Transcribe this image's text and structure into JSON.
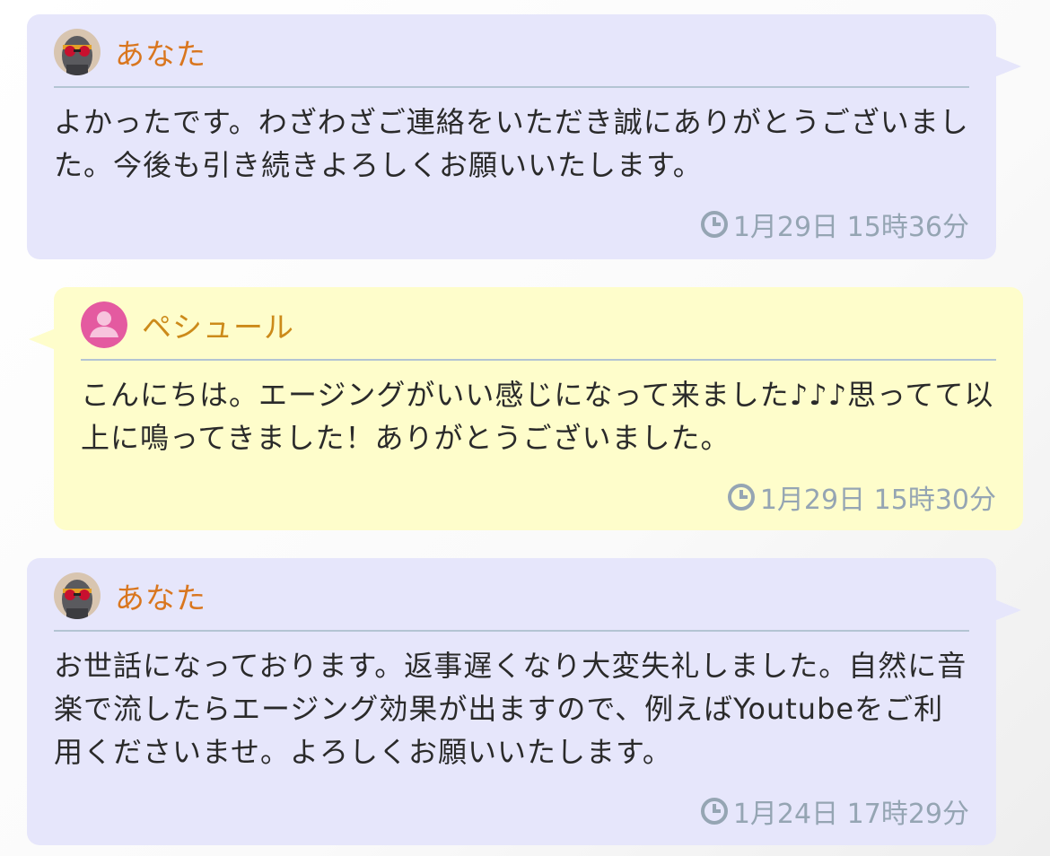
{
  "messages": [
    {
      "sender": "あなた",
      "text": "よかったです。わざわざご連絡をいただき誠にありがとうございました。今後も引き続きよろしくお願いいたします。",
      "time": "1月29日 15時36分"
    },
    {
      "sender": "ペシュール",
      "text": "こんにちは。エージングがいい感じになって来ました♪♪♪思ってて以上に鳴ってきました！ありがとうございました。",
      "time": "1月29日 15時30分"
    },
    {
      "sender": "あなた",
      "text": "お世話になっております。返事遅くなり大変失礼しました。自然に音楽で流したらエージング効果が出ますので、例えばYoutubeをご利用くださいませ。よろしくお願いいたします。",
      "time": "1月24日 17時29分"
    }
  ],
  "colors": {
    "mine_bubble": "#e6e6fb",
    "theirs_bubble": "#fefdcb",
    "name_text": "#d9761e",
    "time_text": "#95a5b3",
    "divider": "#b3c4d3"
  },
  "icons": {
    "my_avatar": "sunglasses-avatar-icon",
    "their_avatar": "user-silhouette-icon",
    "time": "clock-icon"
  }
}
